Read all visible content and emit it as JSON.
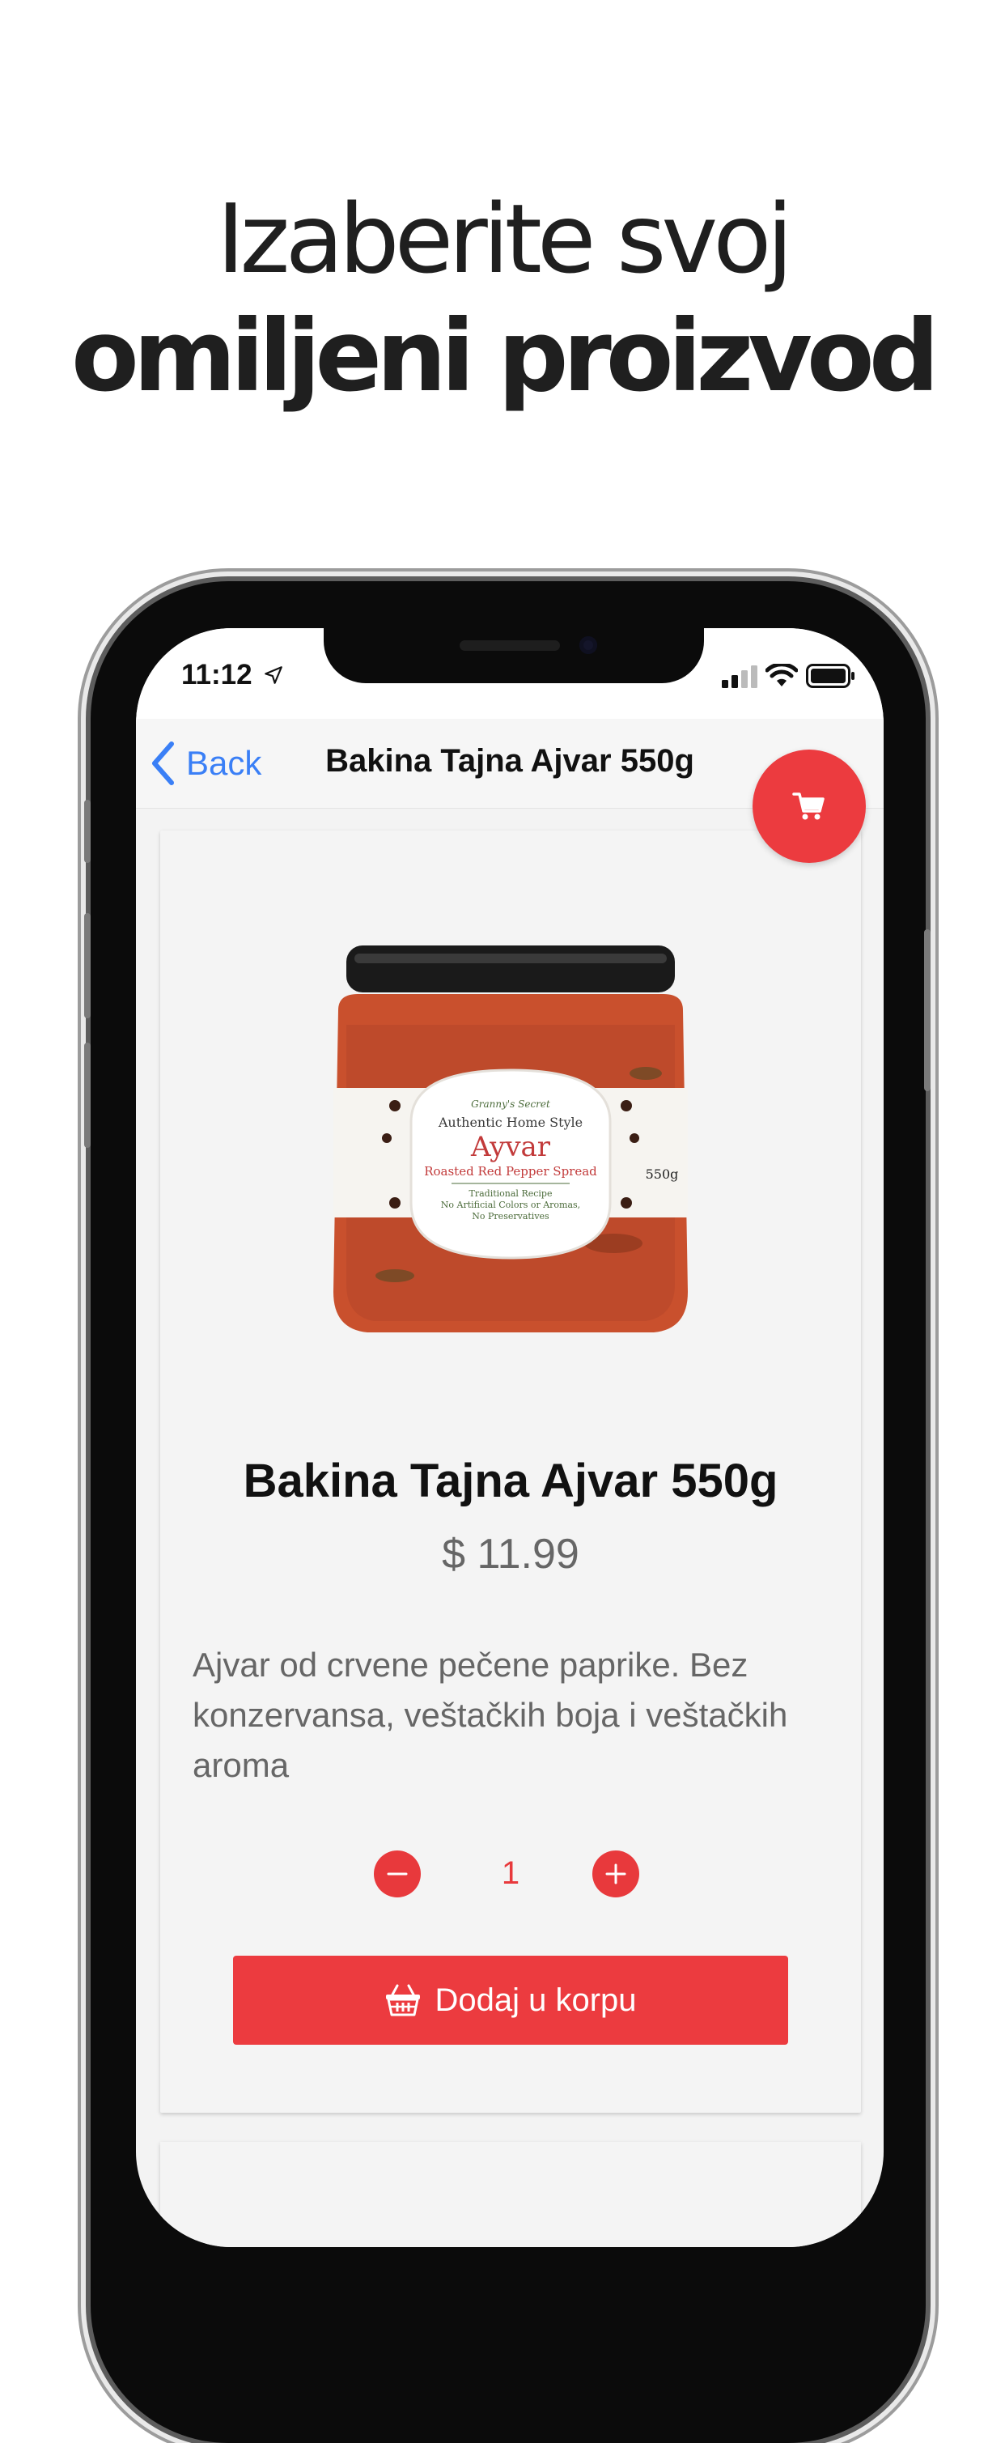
{
  "headline": {
    "line1": "Izaberite svoj",
    "line2": "omiljeni proizvod"
  },
  "status_bar": {
    "time": "11:12",
    "location_icon": "location-arrow-icon",
    "signal_icon": "cellular-signal-icon",
    "wifi_icon": "wifi-icon",
    "battery_icon": "battery-icon"
  },
  "nav": {
    "back_label": "Back",
    "title": "Bakina Tajna Ajvar 550g"
  },
  "product": {
    "name": "Bakina Tajna Ajvar 550g",
    "price": "$ 11.99",
    "description": "Ajvar od crvene pečene paprike. Bez konzervansa, veštačkih boja i veštačkih aroma",
    "image_label": {
      "brand": "Granny's Secret",
      "style": "Authentic Home Style",
      "name": "Ayvar",
      "subtitle": "Roasted Red Pepper Spread",
      "line1": "Traditional Recipe",
      "line2": "No Artificial Colors or Aromas,",
      "line3": "No Preservatives",
      "weight": "550g"
    }
  },
  "quantity": {
    "value": "1",
    "decrease_icon": "minus-icon",
    "increase_icon": "plus-icon"
  },
  "add_to_cart": {
    "label": "Dodaj u korpu",
    "icon": "basket-icon"
  },
  "colors": {
    "accent": "#ec3b3f",
    "link": "#3a7ff6",
    "text": "#111111",
    "muted": "#666666"
  }
}
